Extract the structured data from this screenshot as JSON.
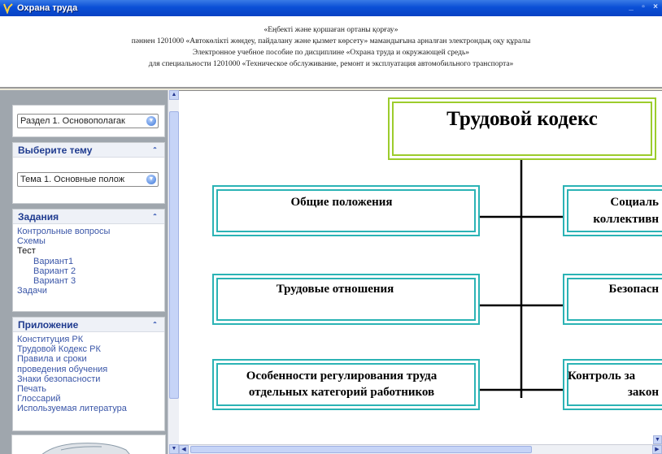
{
  "window": {
    "title": "Охрана труда",
    "controls": [
      "_",
      "▫",
      "×"
    ]
  },
  "header": {
    "line1": "«Еңбекті  және қоршаған ортаны қорғау»",
    "line2": "пәннен 1201000 «Автокөлікті жөндеу,  пайдалану және қызмет көрсету» мамандығына арналған  электрондық  оқу  құралы",
    "line3": "Электронное учебное пособие по дисциплине  «Охрана труда и окружающей средь»",
    "line4": "для специальности  1201000 «Техническое обслуживание, ремонт и эксплуатация автомобильного  транспорта»"
  },
  "sidebar": {
    "section_select": {
      "value": "Раздел 1. Основополагак"
    },
    "topic_panel": {
      "title": "Выберите тему",
      "collapse_icon": "double-chevron-up-icon"
    },
    "topic_select": {
      "value": "Тема 1. Основные полож"
    },
    "tasks_panel": {
      "title": "Задания",
      "items": [
        {
          "label": "Контрольные вопросы"
        },
        {
          "label": "Схемы"
        },
        {
          "label": "Тест"
        },
        {
          "label": "Вариант1"
        },
        {
          "label": "Вариант 2"
        },
        {
          "label": "Вариант 3"
        },
        {
          "label": "Задачи"
        }
      ]
    },
    "appendix_panel": {
      "title": "Приложение",
      "items": [
        {
          "label": "Конституция РК"
        },
        {
          "label": "Трудовой Кодекс РК"
        },
        {
          "label": "Правила и сроки"
        },
        {
          "label": "проведения обучения"
        },
        {
          "label": "Знаки безопасности"
        },
        {
          "label": "Печать"
        },
        {
          "label": "Глоссарий"
        },
        {
          "label": "Используемая литература"
        }
      ]
    }
  },
  "diagram": {
    "root": "Трудовой кодекс",
    "left": [
      "Общие положения",
      "Трудовые отношения",
      "Особенности регулирования труда",
      "отдельных категорий работников"
    ],
    "right": [
      "Социаль",
      "коллективн",
      "Безопасн",
      "Контроль за",
      "закон"
    ],
    "colors": {
      "root_border": "#9ccc2c",
      "box_border": "#2bb3b5",
      "connector": "#000000"
    }
  }
}
